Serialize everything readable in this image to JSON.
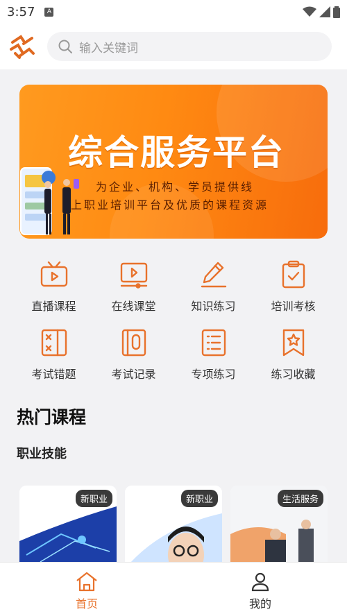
{
  "status": {
    "time": "3:57"
  },
  "search": {
    "placeholder": "输入关键词"
  },
  "banner": {
    "title": "综合服务平台",
    "line1": "为企业、机构、学员提供线",
    "line2": "上职业培训平台及优质的课程资源"
  },
  "shortcuts": [
    {
      "label": "直播课程",
      "icon": "tv-icon"
    },
    {
      "label": "在线课堂",
      "icon": "video-player-icon"
    },
    {
      "label": "知识练习",
      "icon": "pencil-icon"
    },
    {
      "label": "培训考核",
      "icon": "clipboard-check-icon"
    },
    {
      "label": "考试错题",
      "icon": "wrong-answers-icon"
    },
    {
      "label": "考试记录",
      "icon": "record-book-icon"
    },
    {
      "label": "专项练习",
      "icon": "list-doc-icon"
    },
    {
      "label": "练习收藏",
      "icon": "bookmark-star-icon"
    }
  ],
  "section": {
    "title": "热门课程",
    "subtitle": "职业技能"
  },
  "courses": [
    {
      "tag": "新职业"
    },
    {
      "tag": "新职业"
    },
    {
      "tag": "生活服务"
    }
  ],
  "tabs": [
    {
      "label": "首页",
      "active": true
    },
    {
      "label": "我的",
      "active": false
    }
  ],
  "colors": {
    "accent": "#e8722c",
    "banner": "#ff8a12"
  }
}
